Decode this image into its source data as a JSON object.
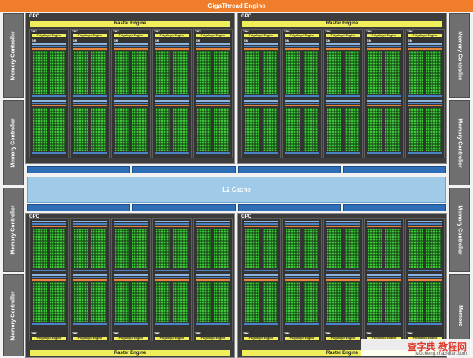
{
  "top_bar": {
    "label": "GigaThread Engine"
  },
  "l2_cache": {
    "label": "L2 Cache"
  },
  "memory_controllers": {
    "left": [
      "Memory Controller",
      "Memory Controller",
      "Memory Controller",
      "Memory Controller"
    ],
    "right": [
      "Memory Controller",
      "Memory Controller",
      "Memory Controller",
      "Memorc"
    ]
  },
  "gpcs": [
    {
      "label": "GPC",
      "raster": "Raster Engine",
      "tpc_label": "TPC",
      "poly_label": "PolyMorph Engine",
      "sm_label": "SM"
    },
    {
      "label": "GPC",
      "raster": "Raster Engine",
      "tpc_label": "TPC",
      "poly_label": "PolyMorph Engine",
      "sm_label": "SM"
    },
    {
      "label": "GPC",
      "raster": "Raster Engine",
      "tpc_label": "TPC",
      "poly_label": "PolyMorph Engine",
      "sm_label": "SM"
    },
    {
      "label": "GPC",
      "raster": "Raster Engine",
      "tpc_label": "TPC",
      "poly_label": "PolyMorph Engine",
      "sm_label": "SM"
    }
  ],
  "watermark": {
    "title": "查字典 教程网",
    "url": "jiaocheng.chazidian.com"
  },
  "colors": {
    "gigathread": "#f07d2a",
    "raster": "#f0ee5a",
    "cores": "#3ec83a",
    "l2": "#9fcbe9",
    "crossbar": "#2f6fb8",
    "memory_controller": "#6f6f6f"
  }
}
